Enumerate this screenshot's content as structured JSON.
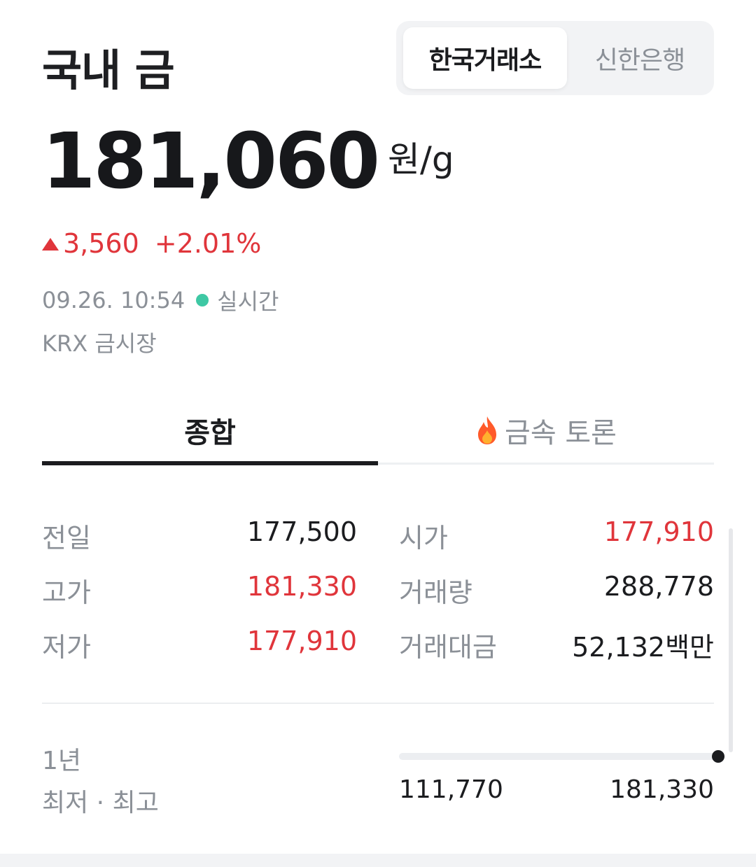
{
  "header": {
    "title": "국내 금"
  },
  "segmented": {
    "options": [
      "한국거래소",
      "신한은행"
    ],
    "selected": "한국거래소"
  },
  "price": {
    "value": "181,060",
    "unit": "원/g"
  },
  "change": {
    "amount": "3,560",
    "percent": "+2.01%",
    "direction": "up",
    "color": "#e0353b"
  },
  "timestamp": {
    "time": "09.26. 10:54",
    "status": "실시간",
    "status_color": "#3ec8a4"
  },
  "market": "KRX 금시장",
  "tabs": {
    "overview": "종합",
    "discussion": "금속 토론",
    "active": "종합"
  },
  "stats": [
    {
      "label": "전일",
      "value": "177,500",
      "tone": "black",
      "label2": "시가",
      "value2": "177,910",
      "tone2": "red"
    },
    {
      "label": "고가",
      "value": "181,330",
      "tone": "red",
      "label2": "거래량",
      "value2": "288,778",
      "tone2": "black"
    },
    {
      "label": "저가",
      "value": "177,910",
      "tone": "red",
      "label2": "거래대금",
      "value2": "52,132백만",
      "tone2": "black"
    }
  ],
  "range": {
    "period": "1년",
    "label": "최저 · 최고",
    "low": "111,770",
    "high": "181,330"
  },
  "icons": {
    "triangle": "up-triangle-icon",
    "fire": "fire-icon",
    "live": "live-dot-icon"
  }
}
